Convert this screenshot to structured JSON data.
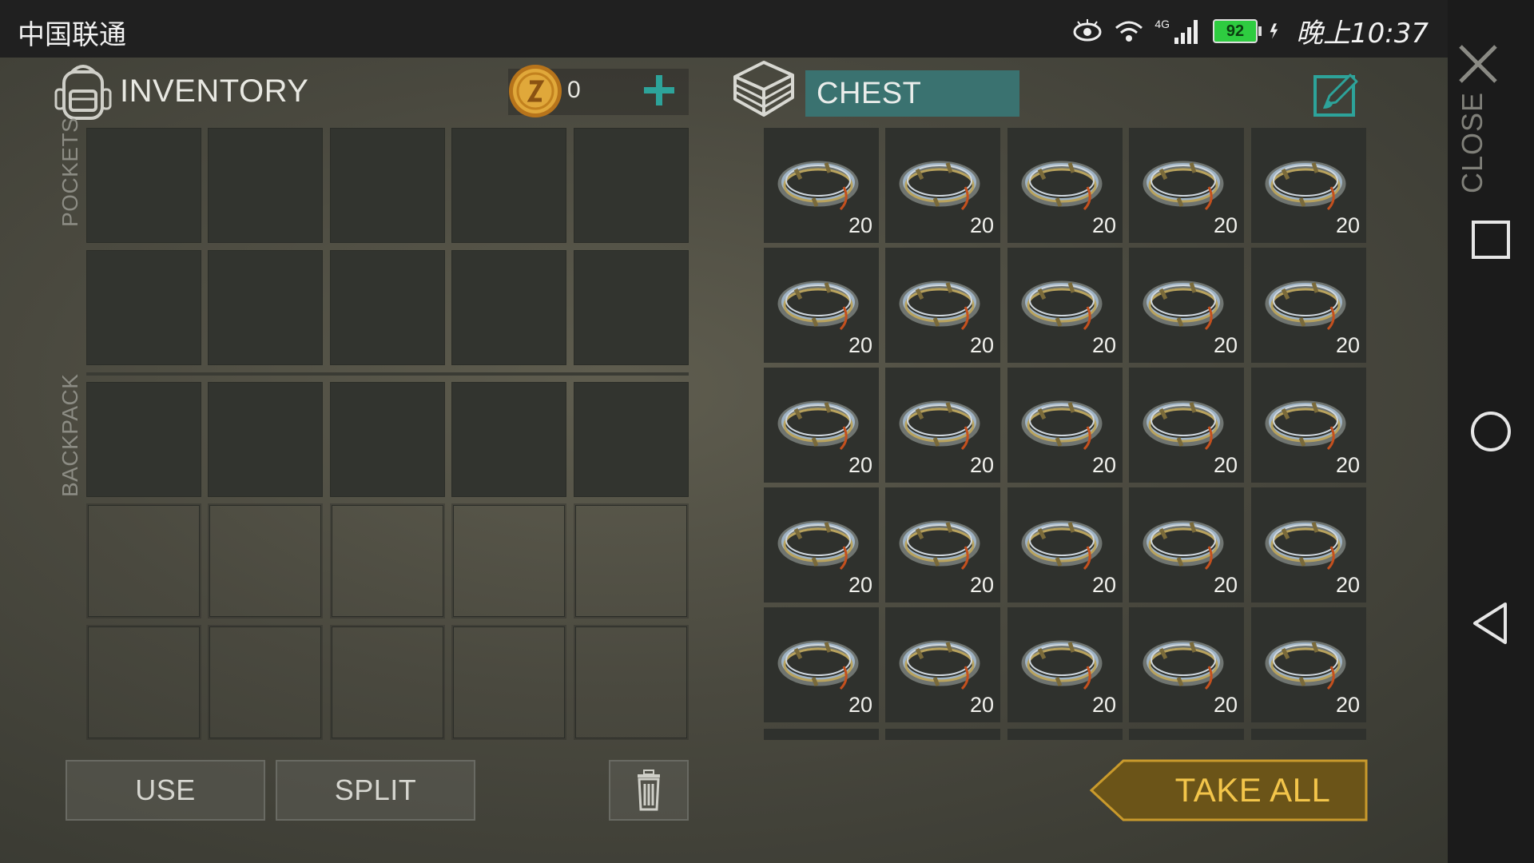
{
  "status_bar": {
    "carrier": "中国联通",
    "network": "4G",
    "battery": "92",
    "time": "晚上10:37"
  },
  "close": {
    "label": "CLOSE"
  },
  "inventory": {
    "title": "INVENTORY",
    "coins": "0",
    "pockets_label": "POCKETS",
    "backpack_label": "BACKPACK"
  },
  "chest": {
    "title": "CHEST",
    "item_icon": "wire-coil-icon",
    "items": [
      {
        "qty": "20"
      },
      {
        "qty": "20"
      },
      {
        "qty": "20"
      },
      {
        "qty": "20"
      },
      {
        "qty": "20"
      },
      {
        "qty": "20"
      },
      {
        "qty": "20"
      },
      {
        "qty": "20"
      },
      {
        "qty": "20"
      },
      {
        "qty": "20"
      },
      {
        "qty": "20"
      },
      {
        "qty": "20"
      },
      {
        "qty": "20"
      },
      {
        "qty": "20"
      },
      {
        "qty": "20"
      },
      {
        "qty": "20"
      },
      {
        "qty": "20"
      },
      {
        "qty": "20"
      },
      {
        "qty": "20"
      },
      {
        "qty": "20"
      },
      {
        "qty": "20"
      },
      {
        "qty": "20"
      },
      {
        "qty": "20"
      },
      {
        "qty": "20"
      },
      {
        "qty": "20"
      }
    ]
  },
  "actions": {
    "use": "USE",
    "split": "SPLIT",
    "take_all": "TAKE ALL"
  },
  "colors": {
    "accent_teal": "#3a7270",
    "take_all_gold": "#f3c54a",
    "battery_green": "#2ecc40"
  }
}
